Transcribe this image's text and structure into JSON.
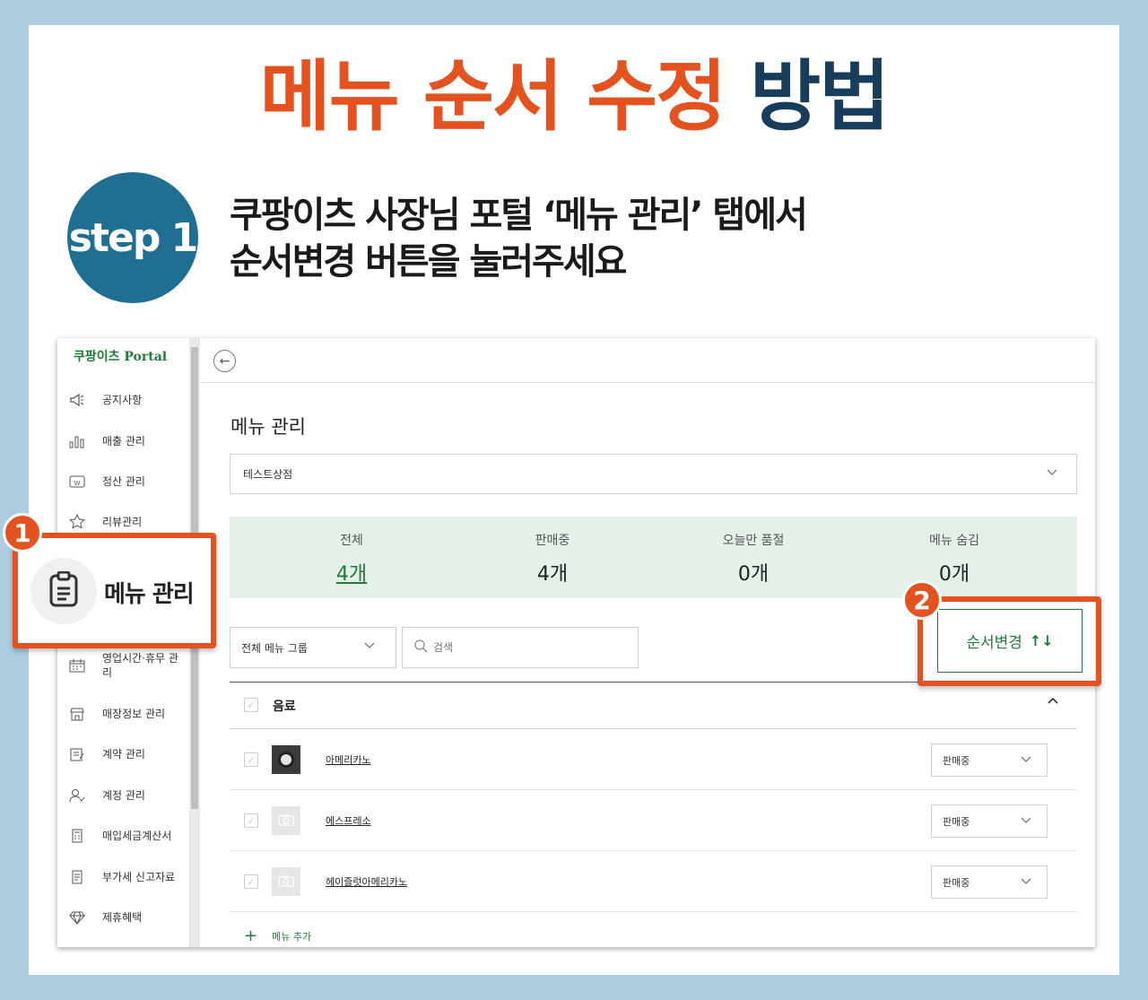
{
  "headline": {
    "part_orange": "메뉴 순서 수정",
    "part_navy": "방법"
  },
  "step": {
    "badge": "step 1",
    "line1": "쿠팡이츠 사장님 포털 ‘메뉴 관리’ 탭에서",
    "line2": "순서변경 버튼을 눌러주세요"
  },
  "sidebar": {
    "brand": "쿠팡이츠 Portal",
    "items": [
      {
        "label": "공지사항",
        "icon": "megaphone-icon"
      },
      {
        "label": "매출 관리",
        "icon": "bar-chart-icon"
      },
      {
        "label": "정산 관리",
        "icon": "settlement-icon"
      },
      {
        "label": "리뷰관리",
        "icon": "star-review-icon"
      },
      {
        "label": "영업시간·휴무 관리",
        "icon": "calendar-icon"
      },
      {
        "label": "매장정보 관리",
        "icon": "store-icon"
      },
      {
        "label": "계약 관리",
        "icon": "contract-icon"
      },
      {
        "label": "계정 관리",
        "icon": "user-icon"
      },
      {
        "label": "매입세금계산서",
        "icon": "calculator-icon"
      },
      {
        "label": "부가세 신고자료",
        "icon": "document-icon"
      },
      {
        "label": "제휴혜택",
        "icon": "diamond-icon"
      }
    ]
  },
  "callouts": {
    "one": {
      "number": "1",
      "label": "메뉴 관리",
      "icon": "clipboard-icon"
    },
    "two": {
      "number": "2"
    }
  },
  "main": {
    "title": "메뉴 관리",
    "store_select": "테스트상점",
    "stats": [
      {
        "label": "전체",
        "value": "4개"
      },
      {
        "label": "판매중",
        "value": "4개"
      },
      {
        "label": "오늘만 품절",
        "value": "0개"
      },
      {
        "label": "메뉴 숨김",
        "value": "0개"
      }
    ],
    "group_select": "전체 메뉴 그룹",
    "search_placeholder": "검색",
    "reorder_button": "순서변경",
    "category": "음료",
    "menus": [
      {
        "name": "아메리카노",
        "status": "판매중"
      },
      {
        "name": "에스프레소",
        "status": "판매중"
      },
      {
        "name": "헤이즐럿아메리카노",
        "status": "판매중"
      }
    ],
    "add_menu": "메뉴 추가"
  },
  "colors": {
    "accent_orange": "#e4521f",
    "navy": "#163e5c",
    "coupang_green": "#1e7b3a",
    "badge_blue": "#1f6f93"
  }
}
